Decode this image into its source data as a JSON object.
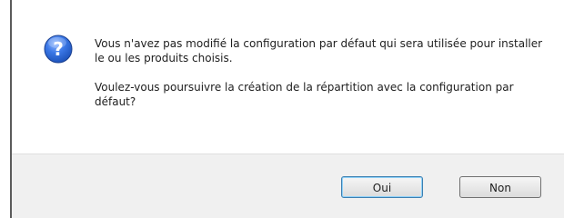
{
  "dialog": {
    "icon": "question-icon",
    "message_line1": "Vous n'avez pas modifié la configuration par défaut qui sera utilisée pour installer le ou les produits choisis.",
    "message_line2": "Voulez-vous poursuivre la création de la répartition avec la configuration par défaut?",
    "buttons": {
      "yes_label": "Oui",
      "no_label": "Non"
    }
  },
  "colors": {
    "icon_blue": "#2a67c9",
    "footer_bg": "#f0f0f0",
    "default_button_border": "#3c7fb1"
  }
}
